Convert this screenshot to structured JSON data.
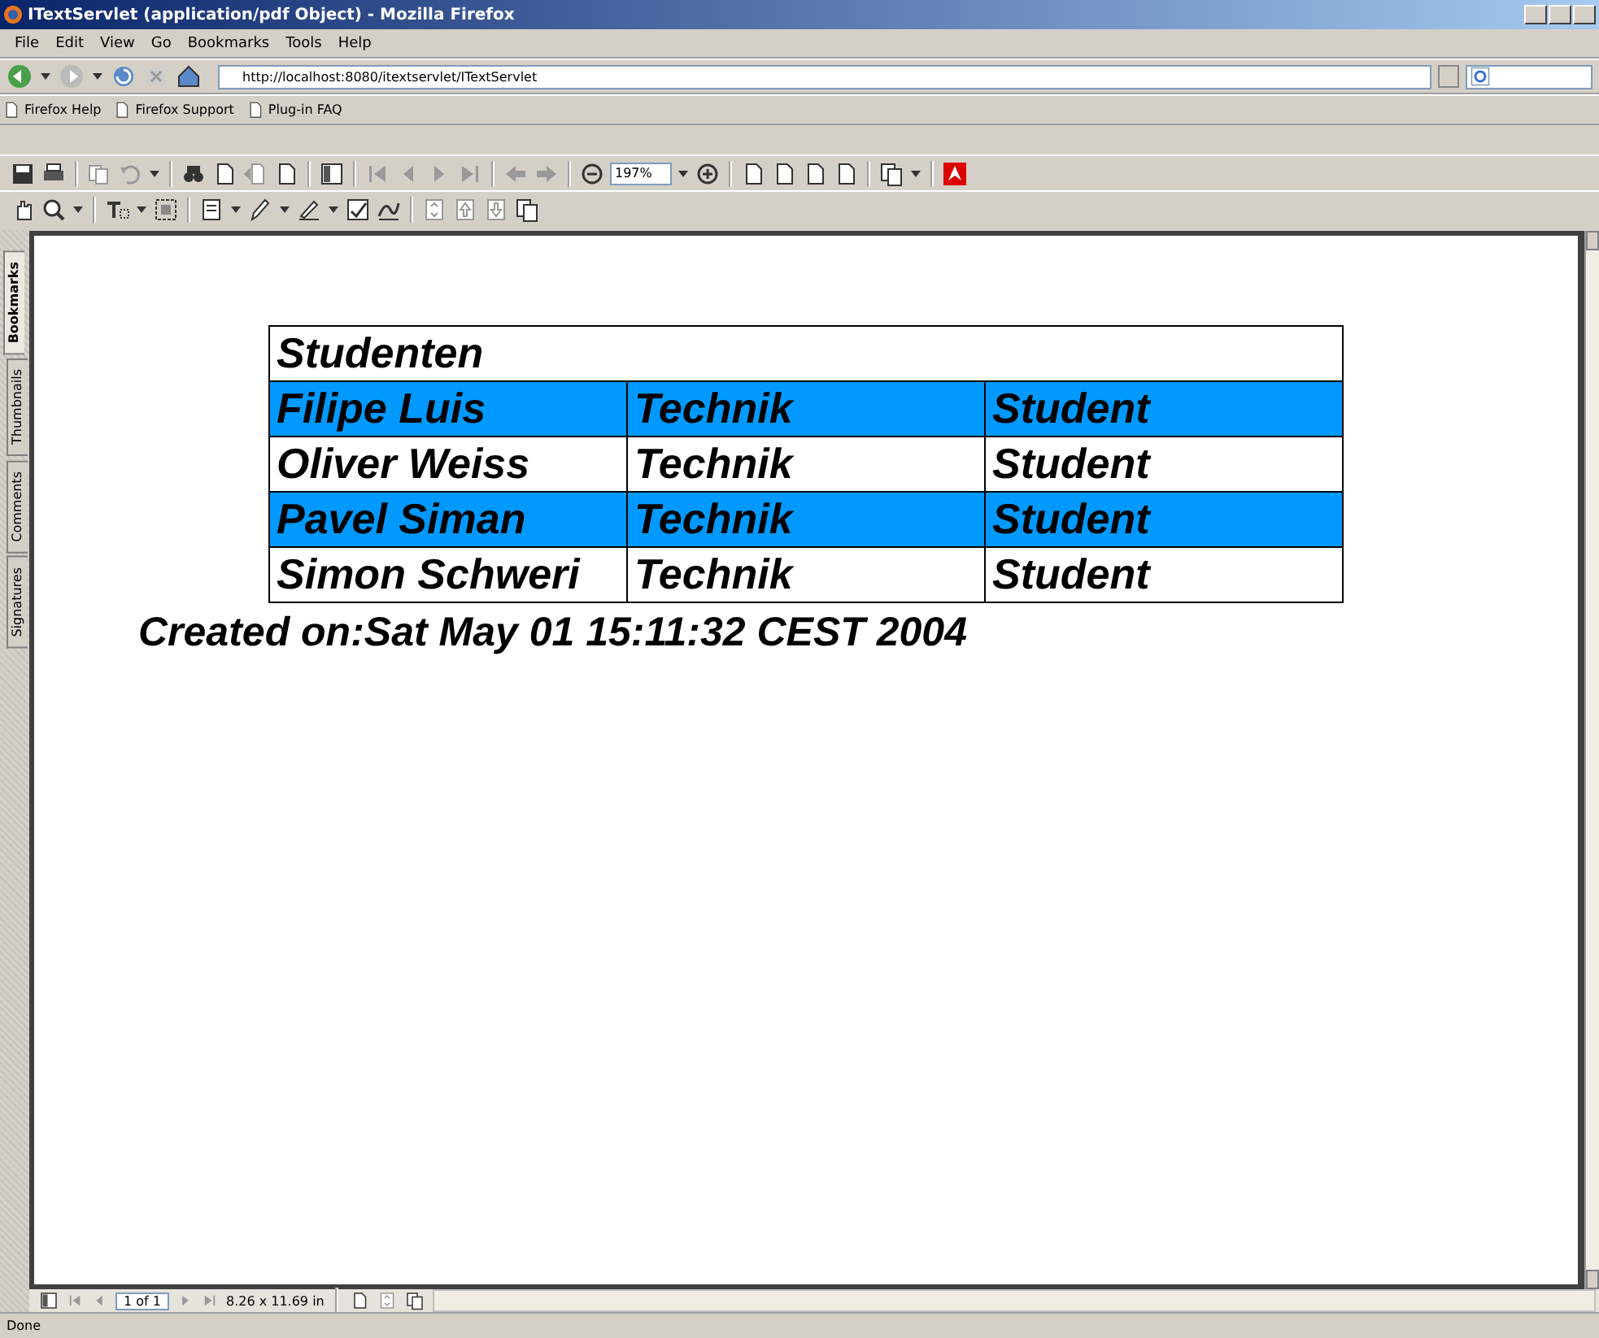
{
  "window": {
    "title": "ITextServlet (application/pdf Object) - Mozilla Firefox"
  },
  "menu_bar": [
    "File",
    "Edit",
    "View",
    "Go",
    "Bookmarks",
    "Tools",
    "Help"
  ],
  "address_bar": {
    "value": "http://localhost:8080/itextservlet/ITextServlet"
  },
  "bookmarks_toolbar": [
    "Firefox Help",
    "Firefox Support",
    "Plug-in FAQ"
  ],
  "pdf_toolbar": {
    "zoom": "197%"
  },
  "side_tabs": [
    {
      "label": "Bookmarks",
      "selected": true
    },
    {
      "label": "Thumbnails",
      "selected": false
    },
    {
      "label": "Comments",
      "selected": false
    },
    {
      "label": "Signatures",
      "selected": false
    }
  ],
  "document": {
    "title": "Studenten",
    "rows": [
      {
        "highlighted": true,
        "cells": [
          "Filipe Luis",
          "Technik",
          "Student"
        ]
      },
      {
        "highlighted": false,
        "cells": [
          "Oliver Weiss",
          "Technik",
          "Student"
        ]
      },
      {
        "highlighted": true,
        "cells": [
          "Pavel Siman",
          "Technik",
          "Student"
        ]
      },
      {
        "highlighted": false,
        "cells": [
          "Simon Schweri",
          "Technik",
          "Student"
        ]
      }
    ],
    "footer": "Created on:Sat May 01 15:11:32 CEST 2004"
  },
  "page_nav": {
    "page": "1 of 1",
    "page_size": "8.26 x 11.69 in"
  },
  "status_bar": {
    "text": "Done"
  }
}
